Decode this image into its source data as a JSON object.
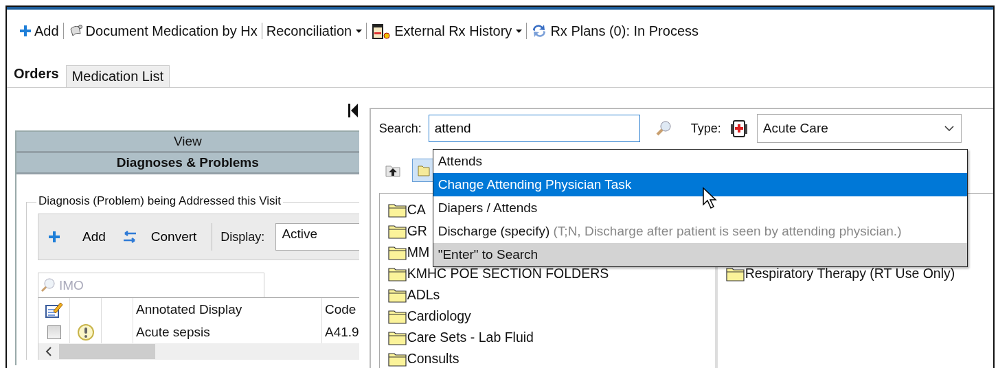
{
  "toolbar": [
    {
      "kind": "button",
      "label": "Add"
    },
    {
      "kind": "button",
      "label": "Document Medication by Hx"
    },
    {
      "kind": "menu",
      "label": "Reconciliation"
    },
    {
      "kind": "menu",
      "label": "External Rx History"
    },
    {
      "kind": "button",
      "label": "Rx Plans (0): In Process"
    }
  ],
  "tabs": [
    {
      "label": "Orders",
      "selected": true
    },
    {
      "label": "Medication List",
      "selected": false
    }
  ],
  "left_panel": {
    "view_header": "View",
    "section_header": "Diagnoses & Problems",
    "group_title": "Diagnosis (Problem) being Addressed this Visit",
    "actions": [
      {
        "label": "Add"
      },
      {
        "label": "Convert"
      }
    ],
    "display_label": "Display:",
    "display_value": "Active",
    "imo_search": {
      "placeholder": "IMO"
    },
    "table": {
      "columns": [
        "Annotated Display",
        "Code"
      ],
      "rows": [
        {
          "checked": false,
          "name": "Acute sepsis",
          "code": "A41.9"
        }
      ]
    }
  },
  "right_panel": {
    "search_label": "Search:",
    "search_value": "attend",
    "type_label": "Type:",
    "type_value": "Acute Care",
    "folders_left": [
      "CA",
      "GR",
      "MM",
      "KMHC POE SECTION FOLDERS",
      "ADLs",
      "Cardiology",
      "Care Sets - Lab Fluid",
      "Consults"
    ],
    "folders_right": [
      "Respiratory Therapy (RT Use Only)"
    ],
    "suggestions": [
      {
        "label": "Attends",
        "selected": false
      },
      {
        "label": "Change Attending Physician Task",
        "selected": true
      },
      {
        "label": "Diapers / Attends",
        "selected": false
      },
      {
        "label": "Discharge (specify)",
        "detail": "(T;N, Discharge after patient is seen by attending physician.)",
        "selected": false
      }
    ],
    "suggestions_footer": "\"Enter\" to Search"
  }
}
